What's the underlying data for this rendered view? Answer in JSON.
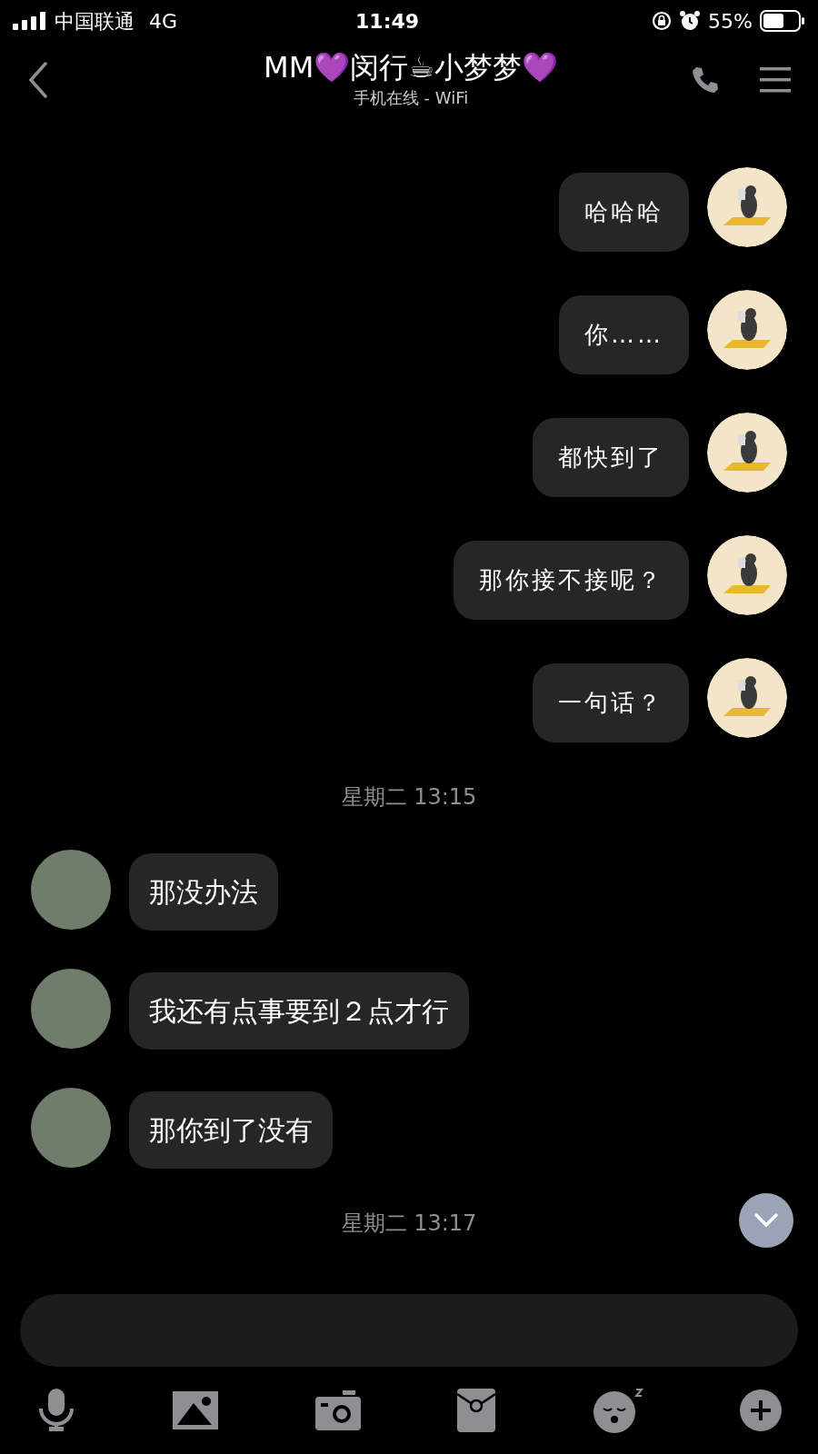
{
  "status_bar": {
    "carrier": "中国联通",
    "network": "4G",
    "time": "11:49",
    "battery": "55%"
  },
  "header": {
    "title": "MM💜闵行☕小梦梦💜",
    "subtitle": "手机在线 - WiFi"
  },
  "messages": [
    {
      "kind": "sent",
      "text": "哈哈哈"
    },
    {
      "kind": "sent",
      "text": "你……"
    },
    {
      "kind": "sent",
      "text": "都快到了"
    },
    {
      "kind": "sent",
      "text": "那你接不接呢？"
    },
    {
      "kind": "sent",
      "text": "一句话？"
    },
    {
      "kind": "time",
      "text": "星期二 13:15"
    },
    {
      "kind": "received",
      "text": "那没办法"
    },
    {
      "kind": "received",
      "text": "我还有点事要到２点才行"
    },
    {
      "kind": "received",
      "text": "那你到了没有"
    },
    {
      "kind": "time",
      "text": "星期二 13:17"
    }
  ]
}
